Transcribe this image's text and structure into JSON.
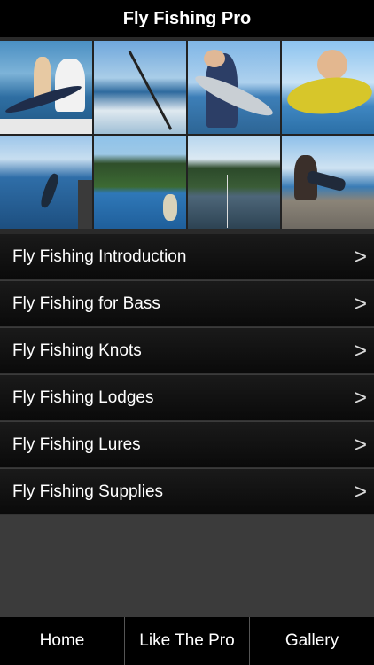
{
  "header": {
    "title": "Fly Fishing Pro"
  },
  "gallery": {
    "photos": [
      {
        "name": "sailfish-catch-photo"
      },
      {
        "name": "boat-wake-rod-photo"
      },
      {
        "name": "striped-bass-photo"
      },
      {
        "name": "mahi-mahi-photo"
      },
      {
        "name": "marlin-jump-photo"
      },
      {
        "name": "lake-wading-photo"
      },
      {
        "name": "river-casting-photo"
      },
      {
        "name": "rock-shore-photo"
      }
    ]
  },
  "menu": {
    "items": [
      {
        "label": "Fly Fishing Introduction"
      },
      {
        "label": "Fly Fishing for Bass"
      },
      {
        "label": "Fly Fishing Knots"
      },
      {
        "label": "Fly Fishing Lodges"
      },
      {
        "label": "Fly Fishing Lures"
      },
      {
        "label": "Fly Fishing Supplies"
      }
    ],
    "chevron": ">"
  },
  "tabbar": {
    "tabs": [
      {
        "label": "Home"
      },
      {
        "label": "Like The Pro"
      },
      {
        "label": "Gallery"
      }
    ]
  }
}
